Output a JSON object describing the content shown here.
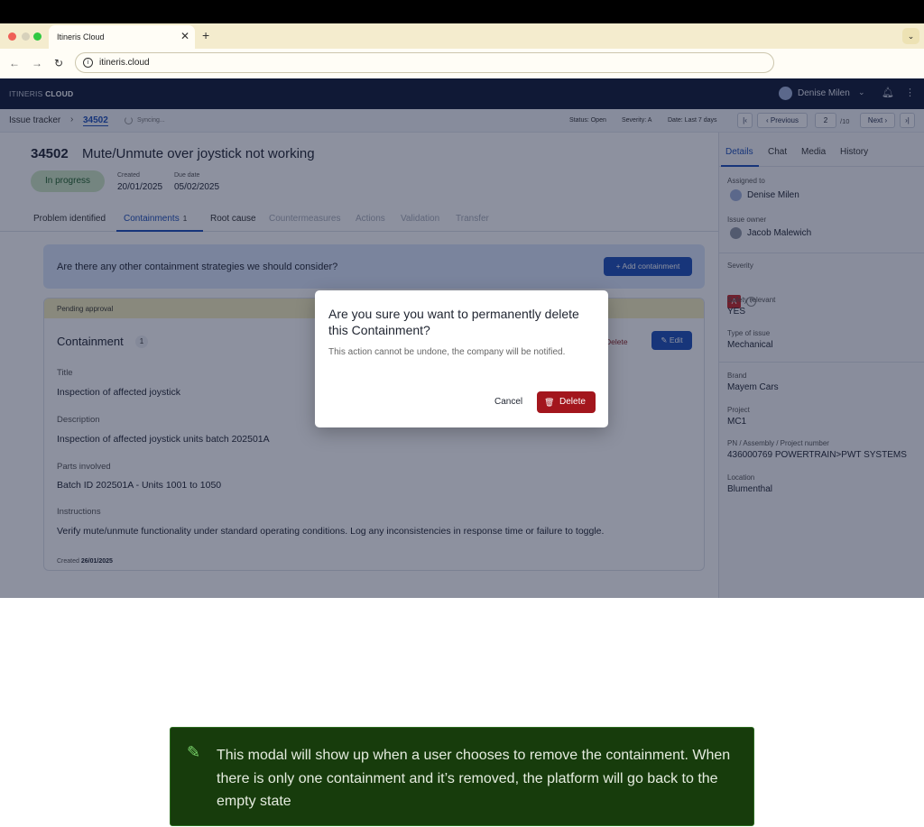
{
  "browser": {
    "tab_title": "Itineris Cloud",
    "tab_close": "✕",
    "new_tab": "+",
    "tab_dropdown": "⌄",
    "back": "←",
    "forward": "→",
    "reload": "↻",
    "url": "itineris.cloud"
  },
  "app": {
    "brand_prefix": "ITINERIS",
    "brand_suffix": "CLOUD",
    "user_name": "Denise Milen"
  },
  "subbar": {
    "crumb_root": "Issue tracker",
    "crumb_sep": "›",
    "crumb_current": "34502",
    "sync_text": "Syncing...",
    "filter_status": "Status: Open",
    "filter_severity": "Severity: A",
    "filter_date": "Date: Last 7 days",
    "first": "|‹",
    "previous": "‹ Previous",
    "page": "2",
    "total": "/10",
    "next": "Next ›",
    "last": "›|"
  },
  "issue": {
    "id": "34502",
    "title": "Mute/Unmute over joystick not working",
    "status": "In progress",
    "created_label": "Created",
    "created": "20/01/2025",
    "due_label": "Due date",
    "due": "05/02/2025"
  },
  "tabs": [
    {
      "label": "Problem identified"
    },
    {
      "label": "Containments",
      "count": "1"
    },
    {
      "label": "Root cause"
    },
    {
      "label": "Countermeasures"
    },
    {
      "label": "Actions"
    },
    {
      "label": "Validation"
    },
    {
      "label": "Transfer"
    }
  ],
  "banner": {
    "question": "Are there any other containment strategies we should consider?",
    "add_label": "+  Add containment"
  },
  "card": {
    "status": "Pending approval",
    "title": "Containment",
    "count": "1",
    "delete_label": "Delete",
    "edit_label": "Edit",
    "fields": [
      {
        "label": "Title",
        "value": "Inspection of affected joystick"
      },
      {
        "label": "Description",
        "value": "Inspection of affected joystick units batch 202501A"
      },
      {
        "label": "Parts involved",
        "value": "Batch ID 202501A - Units 1001 to 1050"
      },
      {
        "label": "Instructions",
        "value": "Verify mute/unmute functionality under standard operating conditions. Log any inconsistencies in response time or failure to toggle."
      }
    ],
    "created_label": "Created",
    "created_date": "26/01/2025"
  },
  "side": {
    "tabs": [
      "Details",
      "Chat",
      "Media",
      "History"
    ],
    "assigned_label": "Assigned to",
    "assigned": "Denise Milen",
    "owner_label": "Issue owner",
    "owner": "Jacob Malewich",
    "severity_label": "Severity",
    "severity": "A",
    "safety_label": "Safety relevant",
    "safety": "YES",
    "type_label": "Type of issue",
    "type": "Mechanical",
    "brand_label": "Brand",
    "brand": "Mayem Cars",
    "project_label": "Project",
    "project": "MC1",
    "pn_label": "PN / Assembly / Project number",
    "pn": "436000769 POWERTRAIN>PWT SYSTEMS",
    "location_label": "Location",
    "location": "Blumenthal"
  },
  "modal": {
    "title": "Are you sure you want to permanently delete this Containment?",
    "body": "This action cannot be undone, the company will be notified.",
    "cancel": "Cancel",
    "delete": "Delete"
  },
  "note": {
    "text": "This modal will show up when a user chooses to remove the containment. When there is only one containment and it’s removed, the platform will go back to the empty state"
  }
}
